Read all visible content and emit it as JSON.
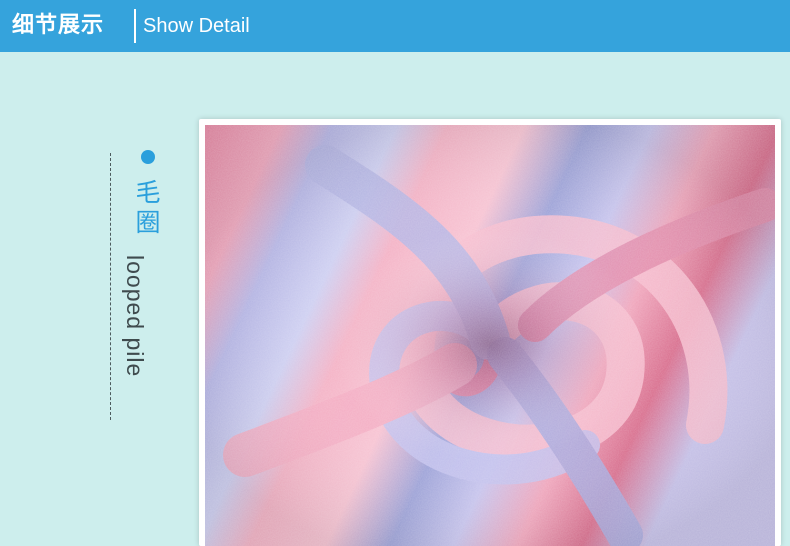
{
  "header": {
    "title_cn": "细节展示",
    "title_en": "Show Detail"
  },
  "feature": {
    "label_cn": "毛圈",
    "label_en": "looped pile"
  },
  "colors": {
    "header_bg": "#35a3dc",
    "page_bg": "#cdeeed",
    "accent": "#2a9fdc"
  }
}
